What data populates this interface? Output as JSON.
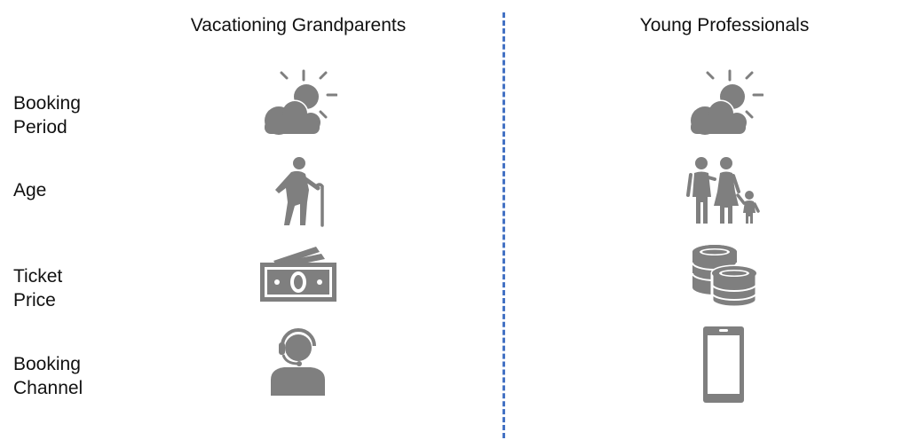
{
  "columns": {
    "left_title": "Vacationing Grandparents",
    "right_title": "Young Professionals"
  },
  "rows": [
    {
      "label_line1": "Booking",
      "label_line2": "Period",
      "left_icon": "partly-sunny-icon",
      "right_icon": "partly-sunny-icon"
    },
    {
      "label_line1": "Age",
      "label_line2": "",
      "left_icon": "elderly-person-icon",
      "right_icon": "family-icon"
    },
    {
      "label_line1": "Ticket",
      "label_line2": "Price",
      "left_icon": "cash-bills-icon",
      "right_icon": "coin-stacks-icon"
    },
    {
      "label_line1": "Booking",
      "label_line2": "Channel",
      "left_icon": "call-center-agent-icon",
      "right_icon": "smartphone-icon"
    }
  ],
  "colors": {
    "icon": "#7f7f7f",
    "divider": "#4472c4",
    "text": "#111111"
  }
}
